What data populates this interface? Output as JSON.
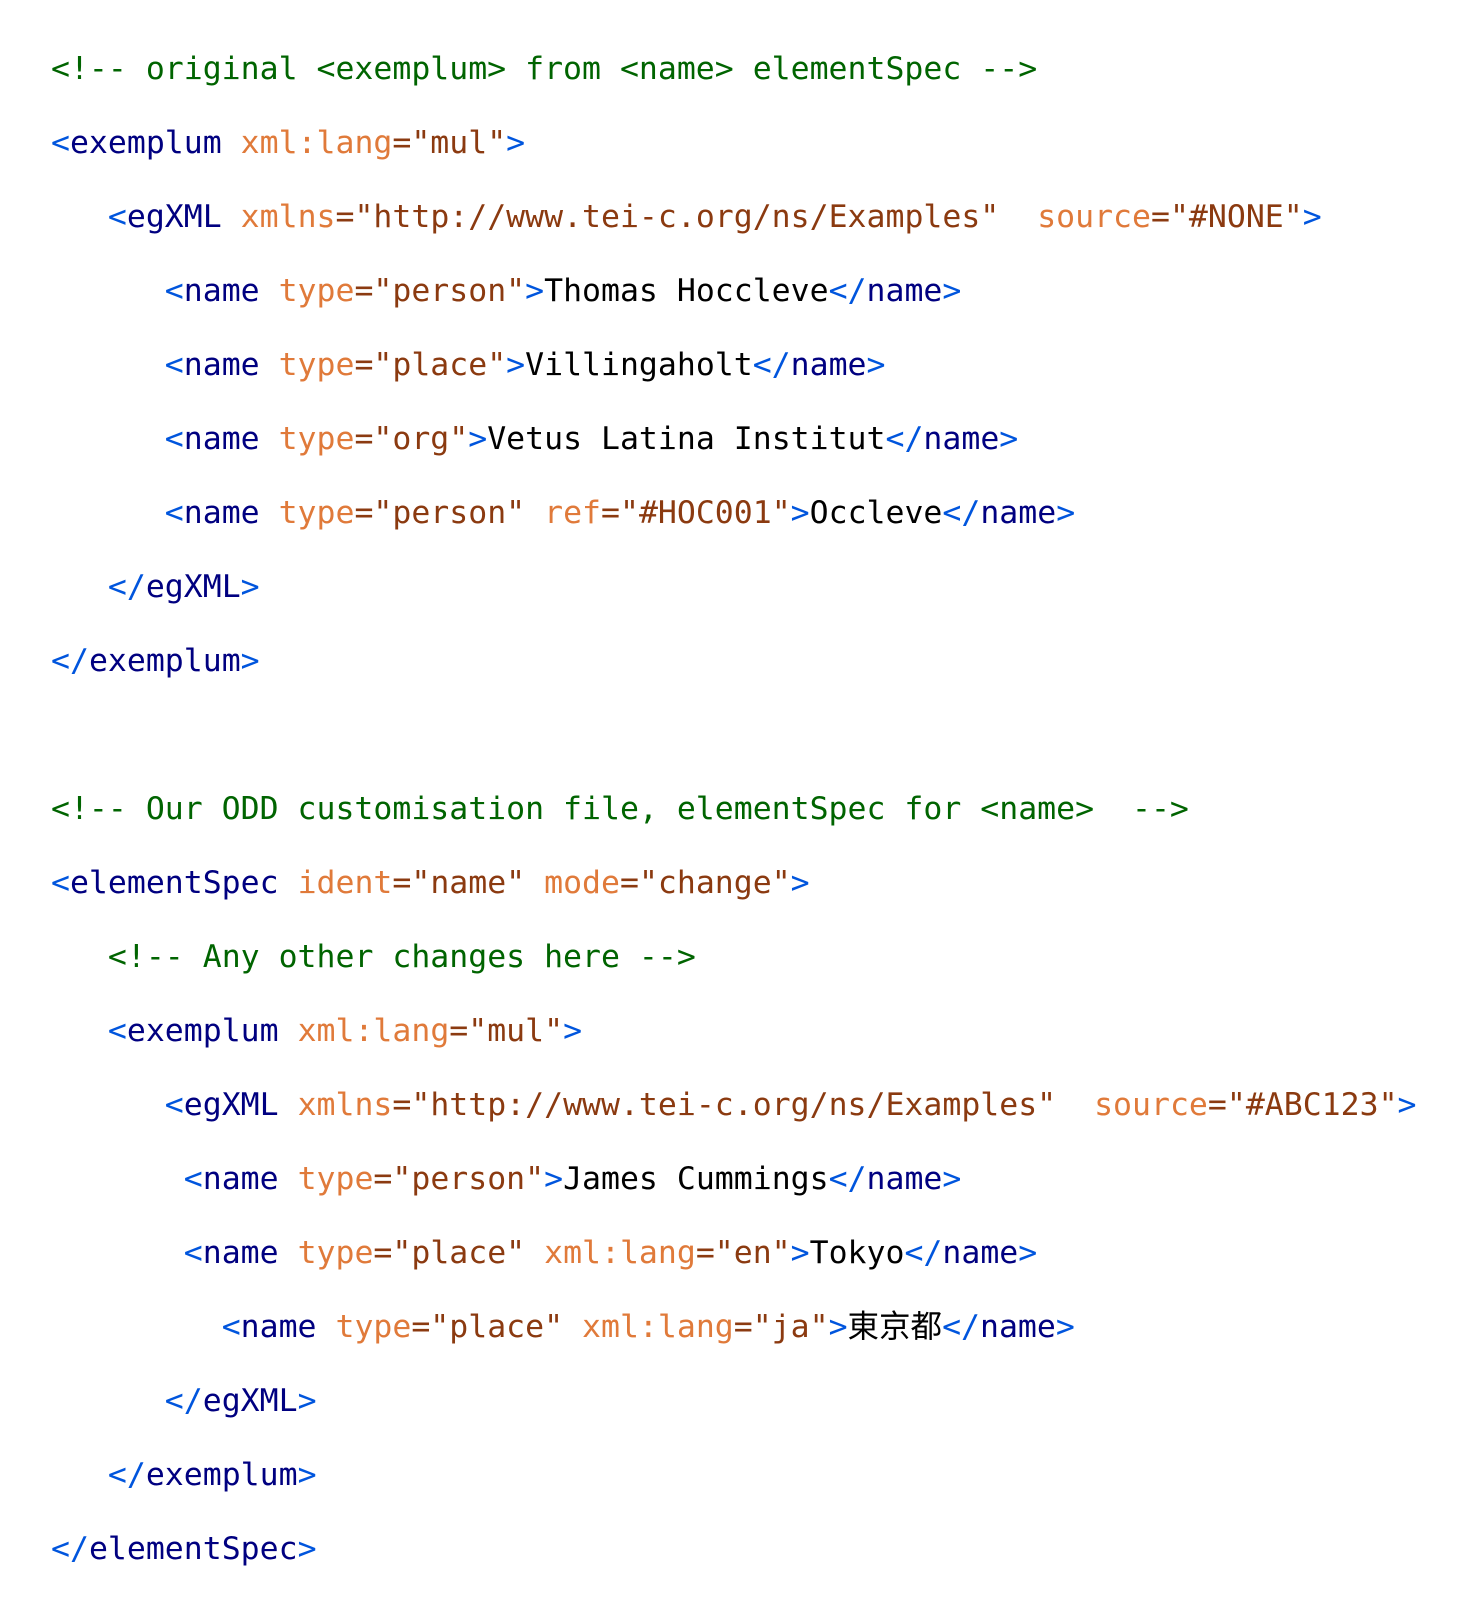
{
  "comments": {
    "c1": "<!-- original <exemplum> from <name> elementSpec -->",
    "c2": "<!-- Our ODD customisation file, elementSpec for <name>  -->",
    "c3": "<!-- Any other changes here -->"
  },
  "tags": {
    "exemplum": "exemplum",
    "egXML": "egXML",
    "name": "name",
    "elementSpec": "elementSpec"
  },
  "attrs": {
    "xml_lang": "xml:lang",
    "xmlns": "xmlns",
    "source": "source",
    "type": "type",
    "ref": "ref",
    "ident": "ident",
    "mode": "mode"
  },
  "values": {
    "mul": "=\"mul\"",
    "ns": "=\"http://www.tei-c.org/ns/Examples\"",
    "none": "=\"#NONE\"",
    "abc": "=\"#ABC123\"",
    "person": "=\"person\"",
    "place": "=\"place\"",
    "org": "=\"org\"",
    "hoc": "=\"#HOC001\"",
    "name": "=\"name\"",
    "change": "=\"change\"",
    "en": "=\"en\"",
    "ja": "=\"ja\""
  },
  "texts": {
    "t1": "Thomas Hoccleve",
    "t2": "Villingaholt",
    "t3": "Vetus Latina Institut",
    "t4": "Occleve",
    "t5": "James Cummings",
    "t6": "Tokyo",
    "t7": "東京都"
  }
}
